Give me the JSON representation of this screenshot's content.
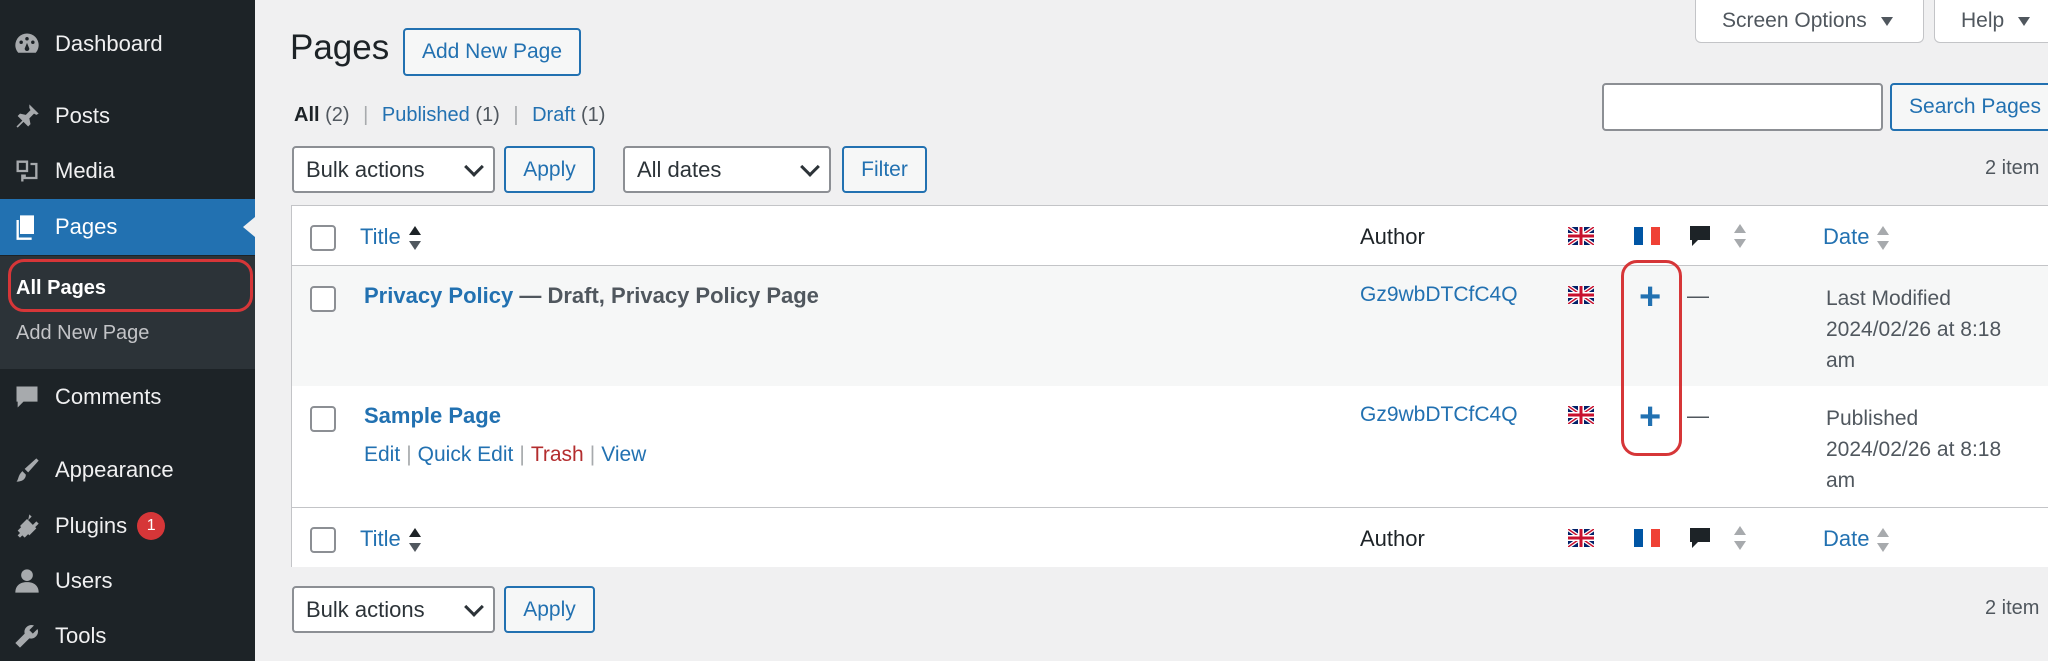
{
  "sidebar": {
    "items": [
      {
        "label": "Dashboard",
        "icon": "dashboard-icon"
      },
      {
        "label": "Posts",
        "icon": "pin-icon"
      },
      {
        "label": "Media",
        "icon": "media-icon"
      },
      {
        "label": "Pages",
        "icon": "pages-icon"
      },
      {
        "label": "Comments",
        "icon": "comment-icon"
      },
      {
        "label": "Appearance",
        "icon": "paintbrush-icon"
      },
      {
        "label": "Plugins",
        "icon": "plugin-icon",
        "badge": "1"
      },
      {
        "label": "Users",
        "icon": "user-icon"
      },
      {
        "label": "Tools",
        "icon": "wrench-icon"
      }
    ],
    "submenu": [
      "All Pages",
      "Add New Page"
    ]
  },
  "header": {
    "title": "Pages",
    "add_new": "Add New Page",
    "screen_options": "Screen Options",
    "help": "Help"
  },
  "filters": {
    "all": "All",
    "all_count": "(2)",
    "published": "Published",
    "published_count": "(1)",
    "draft": "Draft",
    "draft_count": "(1)",
    "sep": "|"
  },
  "search": {
    "button": "Search Pages",
    "value": ""
  },
  "bulk": {
    "label": "Bulk actions",
    "apply": "Apply"
  },
  "dates": {
    "label": "All dates",
    "filter": "Filter"
  },
  "item_count": "2 item",
  "table": {
    "columns": {
      "title": "Title",
      "author": "Author",
      "date": "Date"
    },
    "rows": [
      {
        "title": "Privacy Policy",
        "state": "— Draft, Privacy Policy Page",
        "author": "Gz9wbDTCfC4Q",
        "add_translation": "+",
        "comments": "—",
        "date_status": "Last Modified",
        "date_line1": "2024/02/26 at 8:18",
        "date_line2": "am"
      },
      {
        "title": "Sample Page",
        "state": "",
        "author": "Gz9wbDTCfC4Q",
        "add_translation": "+",
        "comments": "—",
        "date_status": "Published",
        "date_line1": "2024/02/26 at 8:18",
        "date_line2": "am",
        "actions": {
          "edit": "Edit",
          "quick_edit": "Quick Edit",
          "trash": "Trash",
          "view": "View",
          "sep": "|"
        }
      }
    ]
  },
  "colors": {
    "accent": "#2271b1",
    "sidebar": "#1d2327",
    "highlight": "#d63638"
  }
}
